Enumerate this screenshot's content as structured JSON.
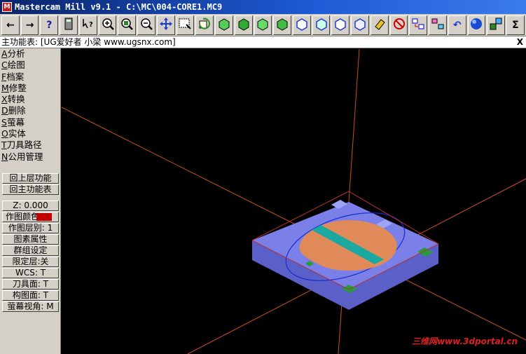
{
  "window": {
    "title": "Mastercam Mill v9.1 - C:\\MC\\004-CORE1.MC9",
    "app_icon_label": "M"
  },
  "toolbar": {
    "buttons": [
      {
        "name": "back-arrow-icon",
        "glyph": "←"
      },
      {
        "name": "forward-arrow-icon",
        "glyph": "→"
      },
      {
        "name": "help-icon",
        "glyph": "?"
      },
      {
        "name": "calculator-icon",
        "glyph": "▤"
      },
      {
        "name": "analyze-icon",
        "glyph": "↖?"
      },
      {
        "name": "zoom-in-icon",
        "glyph": ""
      },
      {
        "name": "zoom-fit-icon",
        "glyph": ""
      },
      {
        "name": "zoom-out-icon",
        "glyph": ""
      },
      {
        "name": "pan-icon",
        "glyph": "✥"
      },
      {
        "name": "window-select-icon",
        "glyph": ""
      },
      {
        "name": "rotate-icon",
        "glyph": ""
      },
      {
        "name": "view-top-icon",
        "glyph": ""
      },
      {
        "name": "view-front-icon",
        "glyph": ""
      },
      {
        "name": "view-side-icon",
        "glyph": ""
      },
      {
        "name": "view-iso-icon",
        "glyph": ""
      },
      {
        "name": "cplane-top-icon",
        "glyph": ""
      },
      {
        "name": "cplane-front-icon",
        "glyph": ""
      },
      {
        "name": "cplane-side-icon",
        "glyph": ""
      },
      {
        "name": "cplane-3d-icon",
        "glyph": ""
      },
      {
        "name": "eraser-icon",
        "glyph": ""
      },
      {
        "name": "delete-icon",
        "glyph": ""
      },
      {
        "name": "transform-icon",
        "glyph": ""
      },
      {
        "name": "group-icon",
        "glyph": ""
      },
      {
        "name": "undo-icon",
        "glyph": "↶"
      },
      {
        "name": "shade-sphere-icon",
        "glyph": ""
      },
      {
        "name": "layers-icon",
        "glyph": ""
      },
      {
        "name": "sum-icon",
        "glyph": "Σ"
      }
    ]
  },
  "prompt": {
    "label": "主功能表: [UG爱好者 小梁 www.ugsnx.com]",
    "close": "X"
  },
  "menu": {
    "items": [
      {
        "key": "A",
        "label": "分析"
      },
      {
        "key": "C",
        "label": "绘图"
      },
      {
        "key": "F",
        "label": "档案"
      },
      {
        "key": "M",
        "label": "修整"
      },
      {
        "key": "X",
        "label": "转换"
      },
      {
        "key": "D",
        "label": "删除"
      },
      {
        "key": "S",
        "label": "萤幕"
      },
      {
        "key": "O",
        "label": "实体"
      },
      {
        "key": "T",
        "label": "刀具路径"
      },
      {
        "key": "N",
        "label": "公用管理"
      }
    ],
    "nav": {
      "back": "回上层功能",
      "main": "回主功能表"
    },
    "status": {
      "z": "Z: 0.000",
      "color": "作图颜色",
      "level": "作图层别: 1",
      "attrib": "图素属性",
      "group": "群组设定",
      "mask": "限定层:关",
      "wcs": "WCS: T",
      "tplane": "刀具面: T",
      "cplane": "构图面: T",
      "gview": "萤幕视角: M"
    }
  },
  "viewport": {
    "watermark": "三维网www.3dportal.cn",
    "colors": {
      "axis": "#c8501e",
      "part_body": "#7b7fe8",
      "part_side": "#5b5fc8",
      "core_copper": "#e08a5a",
      "slot_teal": "#1aa8a0",
      "pad_green": "#2a9a3a"
    }
  }
}
